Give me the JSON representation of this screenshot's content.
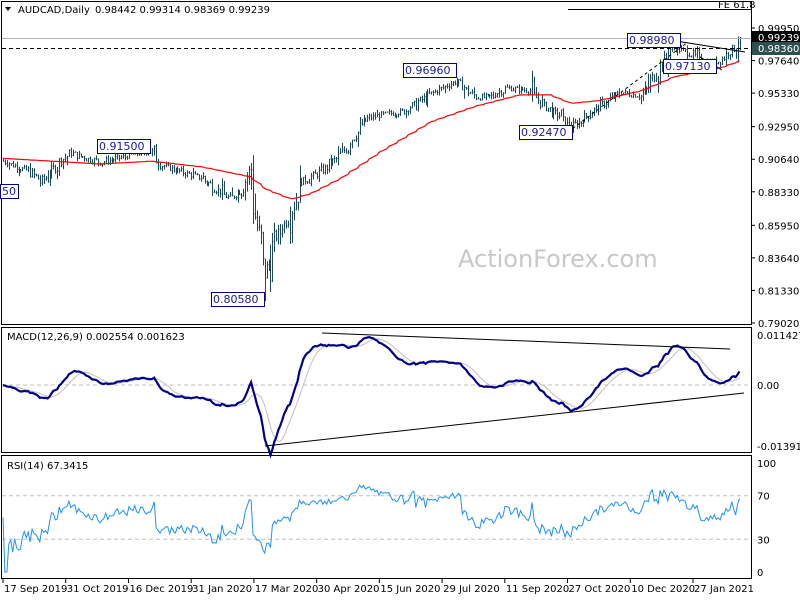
{
  "header": {
    "symbol": "AUDCAD,Daily",
    "ohlc": "0.98442 0.99314 0.98369 0.99239",
    "fe_label": "FE 61.8"
  },
  "watermark": "ActionForex.com",
  "colors": {
    "bars": "#1b4a5e",
    "moving_average": "#ff0000",
    "macd_main": "#00008b",
    "macd_signal": "#c0c0c0",
    "rsi": "#1e90ff",
    "current_price_bg": "#000000",
    "level_price_bg": "#2f4f4f",
    "label_border": "#00008b"
  },
  "chart_data": [
    {
      "type": "ohlc",
      "panel": "price",
      "price_axis_ticks": [
        "0.99950",
        "0.97640",
        "0.95330",
        "0.92950",
        "0.90640",
        "0.88330",
        "0.85950",
        "0.83640",
        "0.81330",
        "0.79020"
      ],
      "ylim": [
        0.7902,
        0.9995
      ],
      "date_ticks": [
        "17 Sep 2019",
        "31 Oct 2019",
        "16 Dec 2019",
        "31 Jan 2020",
        "17 Mar 2020",
        "30 Apr 2020",
        "15 Jun 2020",
        "29 Jul 2020",
        "11 Sep 2020",
        "27 Oct 2020",
        "10 Dec 2020",
        "27 Jan 2021"
      ],
      "current_price": "0.99239",
      "horizontal_level": "0.98360",
      "annotations": [
        {
          "label": "0.98980",
          "date": "2021-01-08"
        },
        {
          "label": "0.97130",
          "date": "2021-02-01"
        },
        {
          "label": "0.96960",
          "date": "2020-08-09"
        },
        {
          "label": "0.92470",
          "date": "2020-10-30"
        },
        {
          "label": "0.91500",
          "date": "2020-01-01"
        },
        {
          "label": "0.80580",
          "date": "2020-03-24"
        },
        {
          "label": "50",
          "date": "2019-10-14"
        }
      ],
      "close_path": [
        [
          "2019-09-17",
          0.905
        ],
        [
          "2019-10-07",
          0.897
        ],
        [
          "2019-10-14",
          0.89
        ],
        [
          "2019-10-28",
          0.905
        ],
        [
          "2019-11-04",
          0.911
        ],
        [
          "2019-11-26",
          0.904
        ],
        [
          "2019-12-20",
          0.91
        ],
        [
          "2020-01-01",
          0.912
        ],
        [
          "2020-01-09",
          0.902
        ],
        [
          "2020-02-07",
          0.893
        ],
        [
          "2020-02-28",
          0.878
        ],
        [
          "2020-03-09",
          0.888
        ],
        [
          "2020-03-13",
          0.9
        ],
        [
          "2020-03-18",
          0.858
        ],
        [
          "2020-03-24",
          0.825
        ],
        [
          "2020-04-01",
          0.852
        ],
        [
          "2020-04-12",
          0.868
        ],
        [
          "2020-04-19",
          0.89
        ],
        [
          "2020-05-04",
          0.898
        ],
        [
          "2020-05-18",
          0.91
        ],
        [
          "2020-06-05",
          0.935
        ],
        [
          "2020-06-16",
          0.938
        ],
        [
          "2020-07-01",
          0.94
        ],
        [
          "2020-07-22",
          0.953
        ],
        [
          "2020-08-09",
          0.962
        ],
        [
          "2020-08-23",
          0.95
        ],
        [
          "2020-09-03",
          0.951
        ],
        [
          "2020-09-14",
          0.957
        ],
        [
          "2020-10-02",
          0.955
        ],
        [
          "2020-10-09",
          0.946
        ],
        [
          "2020-10-24",
          0.936
        ],
        [
          "2020-10-30",
          0.928
        ],
        [
          "2020-11-15",
          0.94
        ],
        [
          "2020-12-06",
          0.954
        ],
        [
          "2020-12-21",
          0.951
        ],
        [
          "2021-01-03",
          0.972
        ],
        [
          "2021-01-12",
          0.986
        ],
        [
          "2021-01-25",
          0.982
        ],
        [
          "2021-02-03",
          0.975
        ],
        [
          "2021-02-15",
          0.976
        ],
        [
          "2021-02-26",
          0.986
        ],
        [
          "2021-03-02",
          0.9924
        ]
      ],
      "moving_average": [
        [
          "2019-09-17",
          0.907
        ],
        [
          "2019-11-26",
          0.903
        ],
        [
          "2020-01-02",
          0.905
        ],
        [
          "2020-02-07",
          0.901
        ],
        [
          "2020-03-13",
          0.894
        ],
        [
          "2020-03-25",
          0.885
        ],
        [
          "2020-04-12",
          0.878
        ],
        [
          "2020-04-26",
          0.882
        ],
        [
          "2020-05-18",
          0.893
        ],
        [
          "2020-06-16",
          0.912
        ],
        [
          "2020-07-22",
          0.933
        ],
        [
          "2020-08-23",
          0.944
        ],
        [
          "2020-09-24",
          0.952
        ],
        [
          "2020-10-16",
          0.952
        ],
        [
          "2020-10-31",
          0.946
        ],
        [
          "2020-11-20",
          0.948
        ],
        [
          "2020-12-21",
          0.955
        ],
        [
          "2021-01-14",
          0.965
        ],
        [
          "2021-02-15",
          0.971
        ],
        [
          "2021-03-02",
          0.976
        ]
      ]
    },
    {
      "type": "line",
      "panel": "macd",
      "title": "MACD(12,26,9) 0.002554 0.001623",
      "axis_ticks": [
        "0.011427",
        "0.00",
        "-0.01391"
      ],
      "ylim": [
        -0.01391,
        0.011427
      ]
    },
    {
      "type": "line",
      "panel": "rsi",
      "title": "RSI(14) 67.3415",
      "axis_ticks": [
        "100",
        "70",
        "30",
        "0"
      ],
      "ylim": [
        0,
        100
      ],
      "levels": [
        70,
        30
      ]
    }
  ]
}
